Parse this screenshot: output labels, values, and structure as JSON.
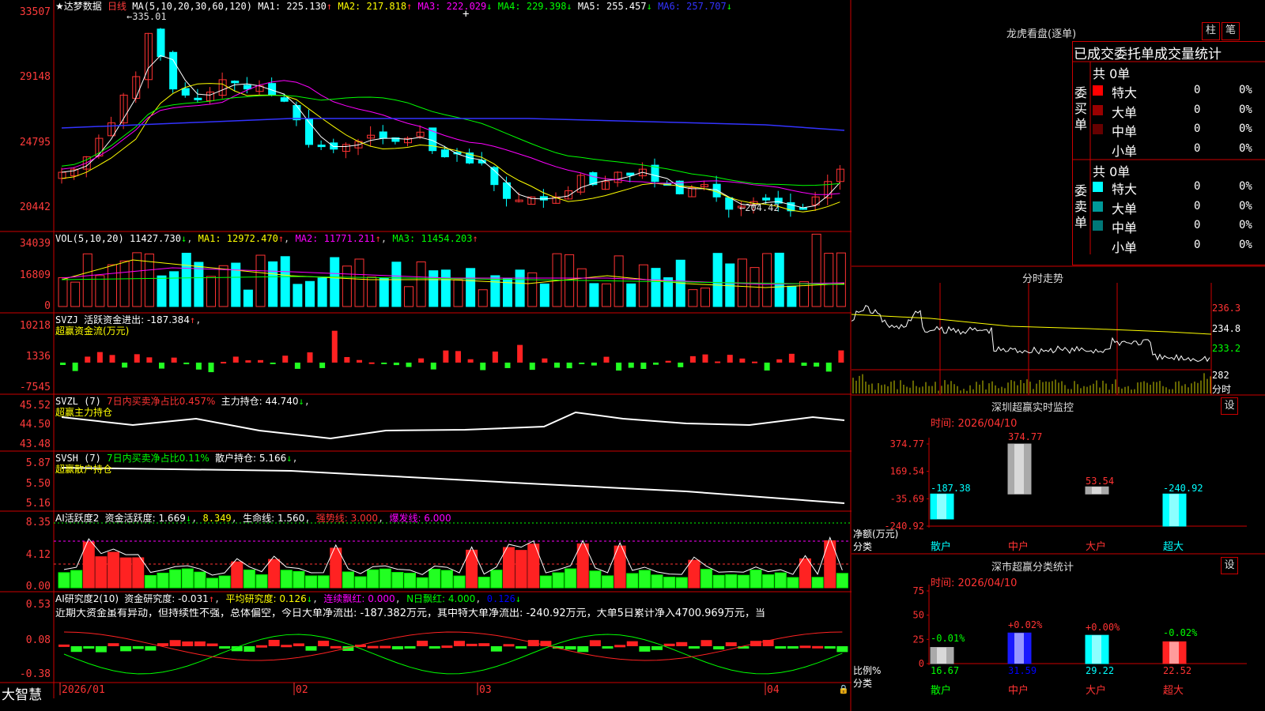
{
  "app": {
    "logo_text": "大智慧",
    "stock_name": "★达梦数据",
    "period_label": "日线"
  },
  "main_panel": {
    "ma_header": "MA(5,10,20,30,60,120)",
    "ma_values": [
      {
        "label": "MA1:",
        "value": "225.130",
        "trend": "↑",
        "color": "#ffffff"
      },
      {
        "label": "MA2:",
        "value": "217.818",
        "trend": "↑",
        "color": "#ffff00"
      },
      {
        "label": "MA3:",
        "value": "222.029",
        "trend": "↓",
        "color": "#ff00ff"
      },
      {
        "label": "MA4:",
        "value": "229.398",
        "trend": "↓",
        "color": "#00ff00"
      },
      {
        "label": "MA5:",
        "value": "255.457",
        "trend": "↓",
        "color": "#ffffff"
      },
      {
        "label": "MA6:",
        "value": "257.707",
        "trend": "↓",
        "color": "#3333ff"
      }
    ],
    "y_ticks": [
      "33507",
      "29148",
      "24795",
      "20442"
    ],
    "high_label": "335.01",
    "low_label": "204.42",
    "x_labels": [
      "2026/01",
      "02",
      "03",
      "04"
    ]
  },
  "vol_panel": {
    "header": "VOL(5,10,20)",
    "value": "11427.730",
    "trend": "↓",
    "ma1": "MA1: 12972.470",
    "ma2": "MA2: 11771.211",
    "ma3": "MA3: 11454.203",
    "y_ticks": [
      "34039",
      "16809",
      "0"
    ]
  },
  "svzj_panel": {
    "header": "SVZJ",
    "text": "活跃资金进出: -187.384",
    "trend": "↑",
    "subtitle": "超赢资金流(万元)",
    "y_ticks": [
      "10218",
      "1336",
      "-7545"
    ]
  },
  "svzl_panel": {
    "header": "SVZL (7)",
    "ratio_text": "7日内买卖净占比0.457%",
    "position_text": "主力持仓: 44.740",
    "trend": "↓",
    "subtitle": "超赢主力持仓",
    "y_ticks": [
      "45.52",
      "44.50",
      "43.48"
    ]
  },
  "svsh_panel": {
    "header": "SVSH (7)",
    "ratio_text": "7日内买卖净占比0.11%",
    "position_text": "散户持仓: 5.166",
    "trend": "↓",
    "subtitle": "超赢散户持仓",
    "y_ticks": [
      "5.87",
      "5.50",
      "5.16"
    ]
  },
  "ai_active_panel": {
    "header": "AI活跃度2",
    "active": "资金活跃度: 1.669",
    "active_trend": "↓",
    "value2": "8.349",
    "life": "生命线: 1.560",
    "strong": "强势线: 3.000",
    "burst": "爆发线: 6.000",
    "y_ticks": [
      "8.35",
      "4.12",
      "0.00"
    ]
  },
  "ai_research_panel": {
    "header": "AI研究度2(10)",
    "research": "资金研究度: -0.031",
    "research_trend": "↑",
    "avg": "平均研究度: 0.126",
    "avg_trend": "↓",
    "consec": "连续飘红: 0.000",
    "nday": "N日飘红: 4.000",
    "nday2": "0.126",
    "comment": "近期大资金虽有异动，但持续性不强，总体偏空，今日大单净流出: -187.382万元，其中特大单净流出: -240.92万元，大单5日累计净入4700.969万元，当",
    "y_ticks": [
      "0.53",
      "0.08",
      "-0.38"
    ]
  },
  "right_panel": {
    "title": "龙虎看盘(逐单)",
    "btn_bar": "柱",
    "btn_pen": "笔",
    "subtitle": "已成交委托单成交量统计",
    "buy": {
      "side_label": "委买单",
      "total": "共 0单",
      "rows": [
        {
          "name": "特大",
          "count": "0",
          "pct": "0%",
          "color": "#ff0000"
        },
        {
          "name": "大单",
          "count": "0",
          "pct": "0%",
          "color": "#990000"
        },
        {
          "name": "中单",
          "count": "0",
          "pct": "0%",
          "color": "#660000"
        },
        {
          "name": "小单",
          "count": "0",
          "pct": "0%",
          "color": ""
        }
      ]
    },
    "sell": {
      "side_label": "委卖单",
      "total": "共 0单",
      "rows": [
        {
          "name": "特大",
          "count": "0",
          "pct": "0%",
          "color": "#00ffff"
        },
        {
          "name": "大单",
          "count": "0",
          "pct": "0%",
          "color": "#009999"
        },
        {
          "name": "中单",
          "count": "0",
          "pct": "0%",
          "color": "#007777"
        },
        {
          "name": "小单",
          "count": "0",
          "pct": "0%",
          "color": ""
        }
      ]
    },
    "intraday": {
      "title": "分时走势",
      "y_ticks": [
        "236.3",
        "234.8",
        "233.2"
      ],
      "vol_label": "282",
      "vol_unit": "分时"
    },
    "monitor": {
      "title": "深圳超赢实时监控",
      "settings": "设",
      "time": "时间: 2026/04/10",
      "y_ticks": [
        "374.77",
        "169.54",
        "-35.69",
        "-240.92"
      ],
      "unit": "净额(万元)",
      "cat_label": "分类",
      "chart_data": {
        "type": "bar",
        "categories": [
          "散户",
          "中户",
          "大户",
          "超大"
        ],
        "values": [
          -187.38,
          374.77,
          53.54,
          -240.92
        ],
        "value_labels": [
          "-187.38",
          "374.77",
          "53.54",
          "-240.92"
        ],
        "ylim": [
          -240.92,
          374.77
        ]
      }
    },
    "stats": {
      "title": "深市超赢分类统计",
      "settings": "设",
      "time": "时间: 2026/04/10",
      "y_ticks": [
        "75",
        "50",
        "25",
        "0"
      ],
      "unit": "比例%",
      "cat_label": "分类",
      "chart_data": {
        "type": "bar",
        "categories": [
          "散户",
          "中户",
          "大户",
          "超大"
        ],
        "values": [
          16.67,
          31.59,
          29.22,
          22.52
        ],
        "change_labels": [
          "-0.01%",
          "+0.02%",
          "+0.00%",
          "-0.02%"
        ],
        "ylim": [
          0,
          75
        ]
      }
    }
  }
}
